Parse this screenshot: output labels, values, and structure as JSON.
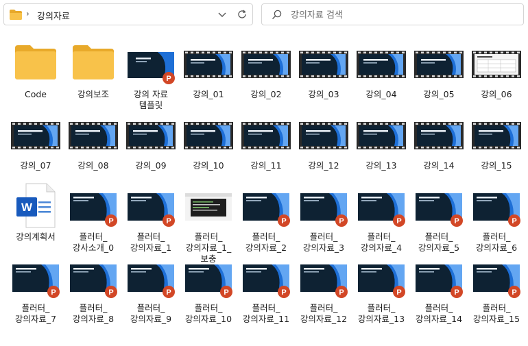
{
  "address_bar": {
    "path": "강의자료"
  },
  "search": {
    "placeholder": "강의자료 검색"
  },
  "items": [
    {
      "name": "Code",
      "type": "folder"
    },
    {
      "name": "강의보조",
      "type": "folder"
    },
    {
      "name": "강의 자료 템플릿",
      "type": "pptx"
    },
    {
      "name": "강의_01",
      "type": "video"
    },
    {
      "name": "강의_02",
      "type": "video"
    },
    {
      "name": "강의_03",
      "type": "video"
    },
    {
      "name": "강의_04",
      "type": "video"
    },
    {
      "name": "강의_05",
      "type": "video"
    },
    {
      "name": "강의_06",
      "type": "video-doc"
    },
    {
      "name": "강의_07",
      "type": "video"
    },
    {
      "name": "강의_08",
      "type": "video"
    },
    {
      "name": "강의_09",
      "type": "video"
    },
    {
      "name": "강의_10",
      "type": "video"
    },
    {
      "name": "강의_11",
      "type": "video"
    },
    {
      "name": "강의_12",
      "type": "video"
    },
    {
      "name": "강의_13",
      "type": "video"
    },
    {
      "name": "강의_14",
      "type": "video"
    },
    {
      "name": "강의_15",
      "type": "video"
    },
    {
      "name": "강의계획서",
      "type": "docx"
    },
    {
      "name": "플러터_강사소개_0",
      "type": "pptx"
    },
    {
      "name": "플러터_강의자료_1",
      "type": "pptx"
    },
    {
      "name": "플러터_강의자료_1_보충",
      "type": "pptx-code"
    },
    {
      "name": "플러터_강의자료_2",
      "type": "pptx"
    },
    {
      "name": "플러터_강의자료_3",
      "type": "pptx"
    },
    {
      "name": "플러터_강의자료_4",
      "type": "pptx"
    },
    {
      "name": "플러터_강의자료_5",
      "type": "pptx"
    },
    {
      "name": "플러터_강의자료_6",
      "type": "pptx"
    },
    {
      "name": "플러터_강의자료_7",
      "type": "pptx"
    },
    {
      "name": "플러터_강의자료_8",
      "type": "pptx"
    },
    {
      "name": "플러터_강의자료_9",
      "type": "pptx"
    },
    {
      "name": "플러터_강의자료_10",
      "type": "pptx"
    },
    {
      "name": "플러터_강의자료_11",
      "type": "pptx"
    },
    {
      "name": "플러터_강의자료_12",
      "type": "pptx"
    },
    {
      "name": "플러터_강의자료_13",
      "type": "pptx"
    },
    {
      "name": "플러터_강의자료_14",
      "type": "pptx"
    },
    {
      "name": "플러터_강의자료_15",
      "type": "pptx"
    }
  ],
  "colors": {
    "folder": "#f8c24a",
    "slide_bg": "#0e2233",
    "accent": "#1e6fd6",
    "ppt": "#d24726",
    "word": "#185abd"
  }
}
